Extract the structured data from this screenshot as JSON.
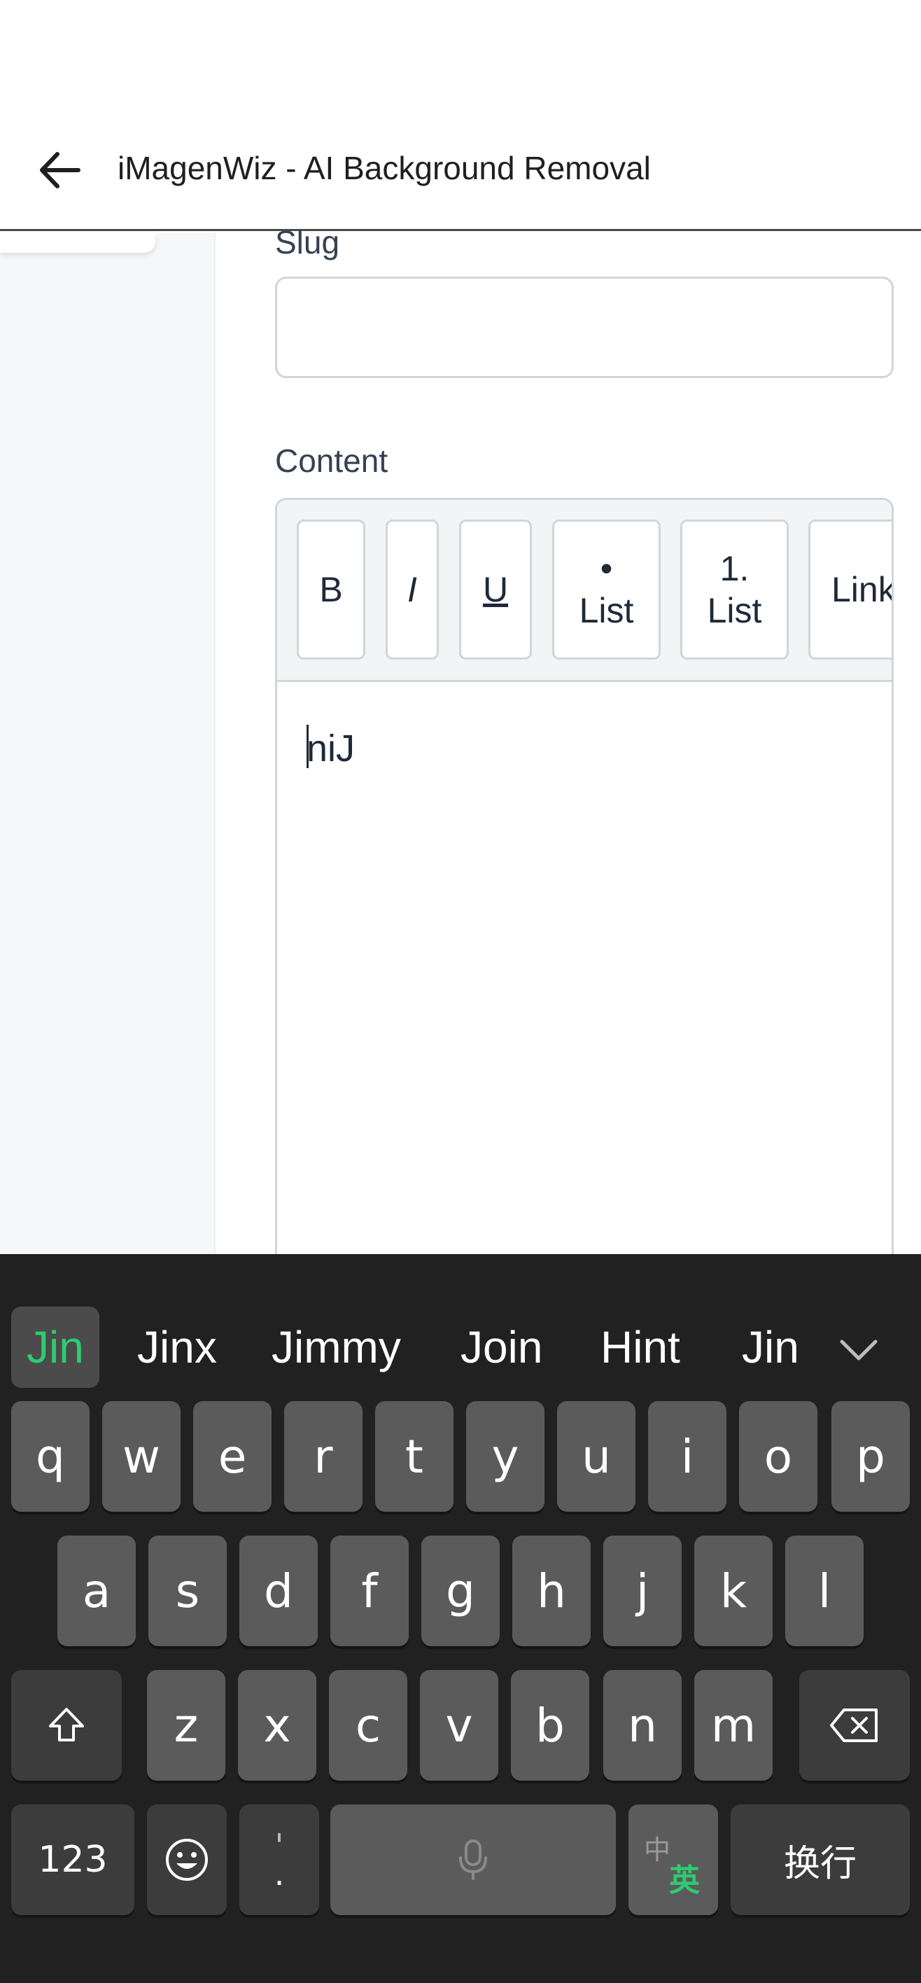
{
  "app": {
    "title": "iMagenWiz - AI Background Removal"
  },
  "form": {
    "slug_label": "Slug",
    "slug_value": "",
    "content_label": "Content",
    "toolbar": {
      "bold": "B",
      "italic": "I",
      "underline": "U",
      "bullet_top": "•",
      "bullet_bottom": "List",
      "ordered_top": "1.",
      "ordered_bottom": "List",
      "link": "Link"
    },
    "content_text": "niJ"
  },
  "keyboard": {
    "suggestions": [
      "Jin",
      "Jinx",
      "Jimmy",
      "Join",
      "Hint",
      "Jin"
    ],
    "row1": [
      "q",
      "w",
      "e",
      "r",
      "t",
      "y",
      "u",
      "i",
      "o",
      "p"
    ],
    "row2": [
      "a",
      "s",
      "d",
      "f",
      "g",
      "h",
      "j",
      "k",
      "l"
    ],
    "row3": [
      "z",
      "x",
      "c",
      "v",
      "b",
      "n",
      "m"
    ],
    "numbers_key": "123",
    "punct_top": "'",
    "punct_bottom": ".",
    "lang_primary": "中",
    "lang_secondary": "英",
    "enter_key": "换行",
    "colors": {
      "background": "#212121",
      "key": "#5b5b5b",
      "accent": "#2ecc71"
    }
  }
}
